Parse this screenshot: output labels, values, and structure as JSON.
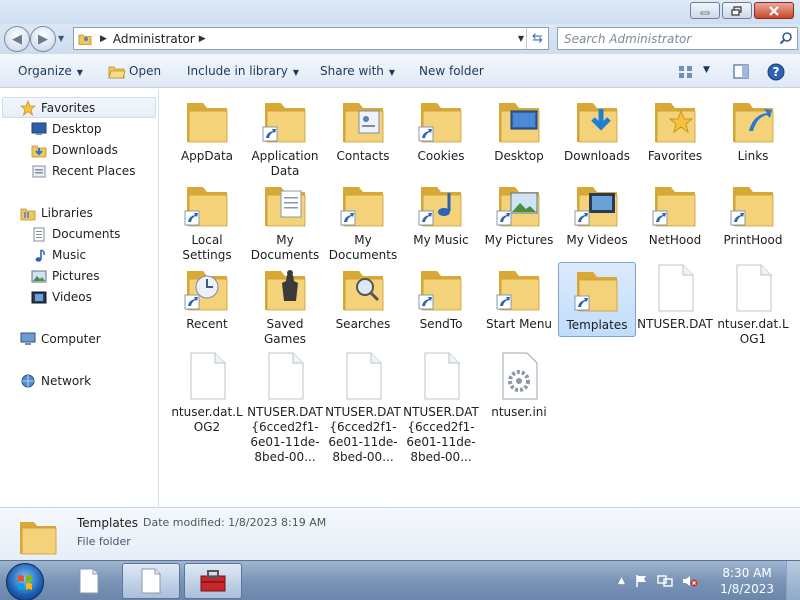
{
  "window": {
    "controls": [
      "minimize",
      "maximize",
      "close"
    ]
  },
  "address": {
    "breadcrumb_root_icon": "folder-user-icon",
    "current": "Administrator",
    "search_placeholder": "Search Administrator"
  },
  "toolbar": {
    "organize": "Organize",
    "open": "Open",
    "include_in_library": "Include in library",
    "share_with": "Share with",
    "new_folder": "New folder"
  },
  "nav": {
    "favorites_header": "Favorites",
    "favorites": [
      "Desktop",
      "Downloads",
      "Recent Places"
    ],
    "libraries_header": "Libraries",
    "libraries": [
      "Documents",
      "Music",
      "Pictures",
      "Videos"
    ],
    "computer": "Computer",
    "network": "Network"
  },
  "items": [
    {
      "label": "AppData",
      "icon": "folder",
      "shortcut": false
    },
    {
      "label": "Application Data",
      "icon": "folder",
      "shortcut": true
    },
    {
      "label": "Contacts",
      "icon": "contacts-folder",
      "shortcut": false
    },
    {
      "label": "Cookies",
      "icon": "folder",
      "shortcut": true
    },
    {
      "label": "Desktop",
      "icon": "desktop-folder",
      "shortcut": false
    },
    {
      "label": "Downloads",
      "icon": "downloads-folder",
      "shortcut": false
    },
    {
      "label": "Favorites",
      "icon": "favorites-folder",
      "shortcut": false
    },
    {
      "label": "Links",
      "icon": "links-folder",
      "shortcut": false
    },
    {
      "label": "Local Settings",
      "icon": "folder",
      "shortcut": true
    },
    {
      "label": "My Documents",
      "icon": "documents-folder",
      "shortcut": false
    },
    {
      "label": "My Documents",
      "icon": "folder",
      "shortcut": true
    },
    {
      "label": "My Music",
      "icon": "music-folder",
      "shortcut": true
    },
    {
      "label": "My Pictures",
      "icon": "pictures-folder",
      "shortcut": true
    },
    {
      "label": "My Videos",
      "icon": "videos-folder",
      "shortcut": true
    },
    {
      "label": "NetHood",
      "icon": "folder",
      "shortcut": true
    },
    {
      "label": "PrintHood",
      "icon": "folder",
      "shortcut": true
    },
    {
      "label": "Recent",
      "icon": "recent-folder",
      "shortcut": true
    },
    {
      "label": "Saved Games",
      "icon": "saved-games-folder",
      "shortcut": false
    },
    {
      "label": "Searches",
      "icon": "searches-folder",
      "shortcut": false
    },
    {
      "label": "SendTo",
      "icon": "folder",
      "shortcut": true
    },
    {
      "label": "Start Menu",
      "icon": "folder",
      "shortcut": true
    },
    {
      "label": "Templates",
      "icon": "folder",
      "shortcut": true,
      "selected": true
    },
    {
      "label": "NTUSER.DAT",
      "icon": "file",
      "shortcut": false
    },
    {
      "label": "ntuser.dat.LOG1",
      "icon": "file",
      "shortcut": false
    },
    {
      "label": "ntuser.dat.LOG2",
      "icon": "file",
      "shortcut": false
    },
    {
      "label": "NTUSER.DAT{6cced2f1-6e01-11de-8bed-00...",
      "icon": "file",
      "shortcut": false
    },
    {
      "label": "NTUSER.DAT{6cced2f1-6e01-11de-8bed-00...",
      "icon": "file",
      "shortcut": false
    },
    {
      "label": "NTUSER.DAT{6cced2f1-6e01-11de-8bed-00...",
      "icon": "file",
      "shortcut": false
    },
    {
      "label": "ntuser.ini",
      "icon": "config-file",
      "shortcut": false
    }
  ],
  "details": {
    "name": "Templates",
    "modified_label": "Date modified: 1/8/2023 8:19 AM",
    "type": "File folder"
  },
  "taskbar": {
    "time": "8:30 AM",
    "date": "1/8/2023",
    "buttons": [
      "notepad-icon",
      "notepad-icon",
      "toolbox-icon"
    ]
  },
  "colors": {
    "folder": "#f3d27a",
    "folder_dark": "#d9a935",
    "selection": "#c1dcfc",
    "accent": "#1e395b"
  }
}
